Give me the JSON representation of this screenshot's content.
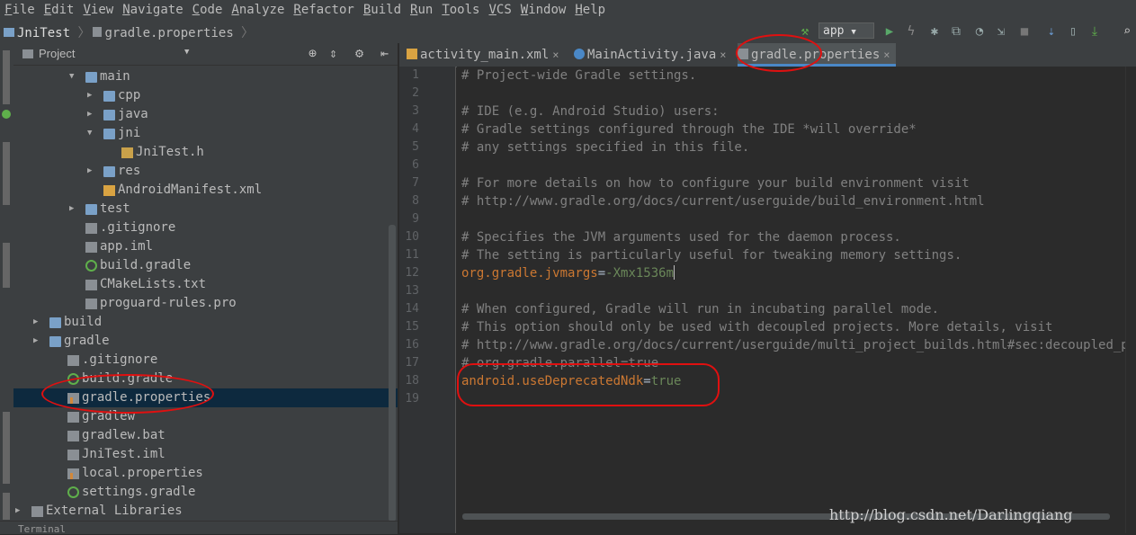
{
  "menu": [
    "File",
    "Edit",
    "View",
    "Navigate",
    "Code",
    "Analyze",
    "Refactor",
    "Build",
    "Run",
    "Tools",
    "VCS",
    "Window",
    "Help"
  ],
  "breadcrumb": {
    "project": "JniTest",
    "file": "gradle.properties"
  },
  "toolbar": {
    "run_config": "app"
  },
  "project_panel": {
    "title": "Project"
  },
  "tree": [
    {
      "label": "main",
      "depth": 0,
      "arrow": "▼",
      "icon": "folder-icon"
    },
    {
      "label": "cpp",
      "depth": 1,
      "arrow": "▶",
      "icon": "folder-icon"
    },
    {
      "label": "java",
      "depth": 1,
      "arrow": "▶",
      "icon": "folder-icon"
    },
    {
      "label": "jni",
      "depth": 1,
      "arrow": "▼",
      "icon": "folder-icon"
    },
    {
      "label": "JniTest.h",
      "depth": 2,
      "arrow": "",
      "icon": "header-file-icon"
    },
    {
      "label": "res",
      "depth": 1,
      "arrow": "▶",
      "icon": "folder-icon"
    },
    {
      "label": "AndroidManifest.xml",
      "depth": 1,
      "arrow": "",
      "icon": "manifest-icon"
    },
    {
      "label": "test",
      "depth": 0,
      "arrow": "▶",
      "icon": "folder-icon"
    },
    {
      "label": ".gitignore",
      "depth": -1,
      "arrow": "",
      "icon": "file-icon"
    },
    {
      "label": "app.iml",
      "depth": -1,
      "arrow": "",
      "icon": "file-icon"
    },
    {
      "label": "build.gradle",
      "depth": -1,
      "arrow": "",
      "icon": "gradle-icon"
    },
    {
      "label": "CMakeLists.txt",
      "depth": -1,
      "arrow": "",
      "icon": "file-icon"
    },
    {
      "label": "proguard-rules.pro",
      "depth": -1,
      "arrow": "",
      "icon": "file-icon"
    },
    {
      "label": "build",
      "depth": -3,
      "arrow": "▶",
      "icon": "folder-icon"
    },
    {
      "label": "gradle",
      "depth": -3,
      "arrow": "▶",
      "icon": "folder-icon"
    },
    {
      "label": ".gitignore",
      "depth": -2,
      "arrow": "",
      "icon": "file-icon"
    },
    {
      "label": "build.gradle",
      "depth": -2,
      "arrow": "",
      "icon": "gradle-icon"
    },
    {
      "label": "gradle.properties",
      "depth": -2,
      "arrow": "",
      "icon": "properties-icon",
      "selected": true
    },
    {
      "label": "gradlew",
      "depth": -2,
      "arrow": "",
      "icon": "file-icon"
    },
    {
      "label": "gradlew.bat",
      "depth": -2,
      "arrow": "",
      "icon": "file-icon"
    },
    {
      "label": "JniTest.iml",
      "depth": -2,
      "arrow": "",
      "icon": "file-icon"
    },
    {
      "label": "local.properties",
      "depth": -2,
      "arrow": "",
      "icon": "properties-icon"
    },
    {
      "label": "settings.gradle",
      "depth": -2,
      "arrow": "",
      "icon": "gradle-icon"
    },
    {
      "label": "External Libraries",
      "depth": -4,
      "arrow": "▶",
      "icon": "library-icon"
    }
  ],
  "bottom": {
    "terminal": "Terminal"
  },
  "tabs": [
    {
      "label": "activity_main.xml",
      "icon": "xml-icon"
    },
    {
      "label": "MainActivity.java",
      "icon": "class-icon"
    },
    {
      "label": "gradle.properties",
      "icon": "properties-icon",
      "active": true
    }
  ],
  "code": [
    {
      "n": "1",
      "type": "comment",
      "text": "# Project-wide Gradle settings."
    },
    {
      "n": "2",
      "type": "blank",
      "text": ""
    },
    {
      "n": "3",
      "type": "comment",
      "text": "# IDE (e.g. Android Studio) users:"
    },
    {
      "n": "4",
      "type": "comment",
      "text": "# Gradle settings configured through the IDE *will override*"
    },
    {
      "n": "5",
      "type": "comment",
      "text": "# any settings specified in this file."
    },
    {
      "n": "6",
      "type": "blank",
      "text": ""
    },
    {
      "n": "7",
      "type": "comment",
      "text": "# For more details on how to configure your build environment visit"
    },
    {
      "n": "8",
      "type": "comment",
      "text": "# http://www.gradle.org/docs/current/userguide/build_environment.html"
    },
    {
      "n": "9",
      "type": "blank",
      "text": ""
    },
    {
      "n": "10",
      "type": "comment",
      "text": "# Specifies the JVM arguments used for the daemon process."
    },
    {
      "n": "11",
      "type": "comment",
      "text": "# The setting is particularly useful for tweaking memory settings."
    },
    {
      "n": "12",
      "type": "prop",
      "key": "org.gradle.jvmargs",
      "value": "-Xmx1536m",
      "caret": true
    },
    {
      "n": "13",
      "type": "blank",
      "text": ""
    },
    {
      "n": "14",
      "type": "comment",
      "text": "# When configured, Gradle will run in incubating parallel mode."
    },
    {
      "n": "15",
      "type": "comment",
      "text": "# This option should only be used with decoupled projects. More details, visit"
    },
    {
      "n": "16",
      "type": "comment",
      "text": "# http://www.gradle.org/docs/current/userguide/multi_project_builds.html#sec:decoupled_projects"
    },
    {
      "n": "17",
      "type": "comment",
      "text": "# org.gradle.parallel=true"
    },
    {
      "n": "18",
      "type": "prop",
      "key": "android.useDeprecatedNdk",
      "value": "true"
    },
    {
      "n": "19",
      "type": "blank",
      "text": ""
    }
  ],
  "watermark": "http://blog.csdn.net/Darlingqiang",
  "colors": {
    "background": "#2b2b2b",
    "panel": "#3c3f41",
    "selection": "#0d293e",
    "comment": "#808080",
    "key": "#cc7832",
    "value": "#6a8759",
    "annotation": "#e01010"
  }
}
